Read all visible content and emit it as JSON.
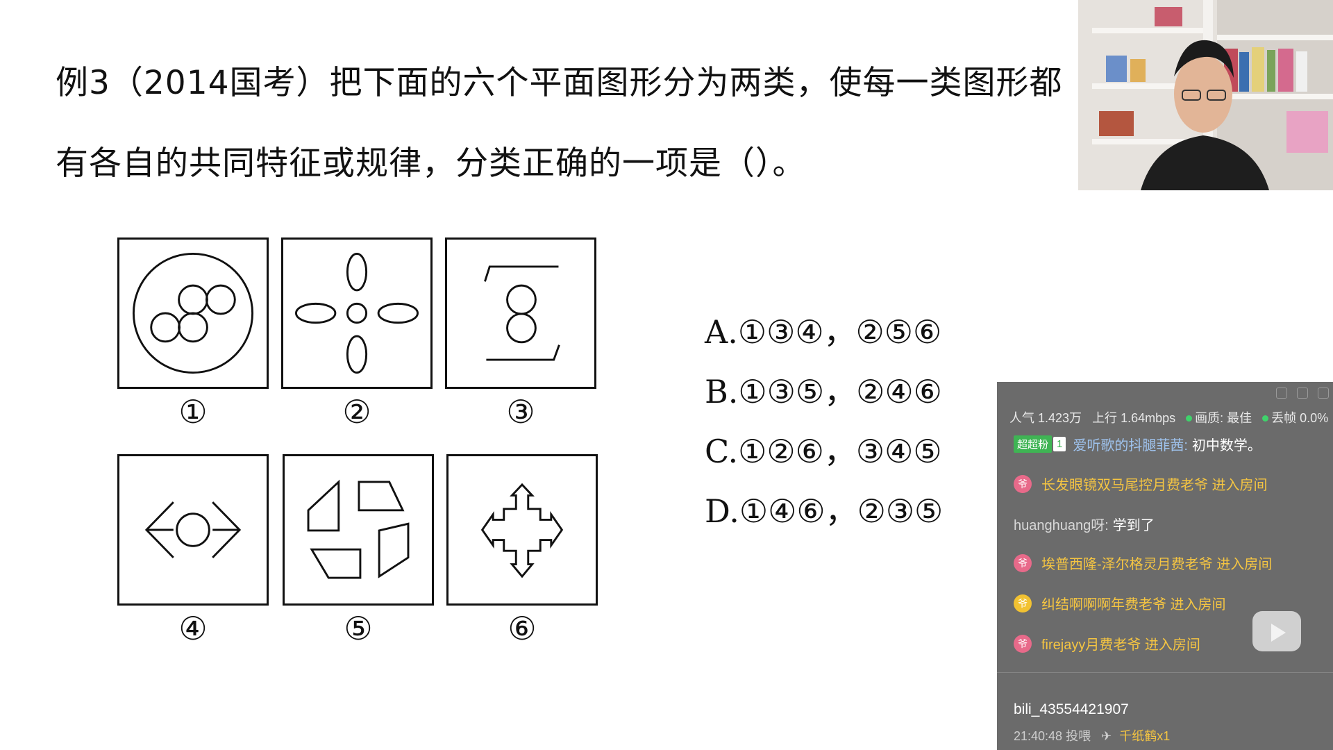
{
  "question": {
    "line1": "例3（2014国考）把下面的六个平面图形分为两类，使每一类图形都",
    "line2": "有各自的共同特征或规律，分类正确的一项是（）。"
  },
  "figures": [
    "①",
    "②",
    "③",
    "④",
    "⑤",
    "⑥"
  ],
  "options": [
    "A.①③④，②⑤⑥",
    "B.①③⑤，②④⑥",
    "C.①②⑥，③④⑤",
    "D.①④⑥，②③⑤"
  ],
  "chat": {
    "stats": {
      "popularity": "人气 1.423万",
      "upload": "上行 1.64mbps",
      "quality": "画质: 最佳",
      "dropped": "丢帧 0.0%"
    },
    "messages": [
      {
        "badge": "超超粉",
        "level": "1",
        "user": "爱听歌的抖腿菲茜:",
        "text": "初中数学。"
      },
      {
        "icon": "爷",
        "text": "长发眼镜双马尾控月费老爷 进入房间"
      },
      {
        "user": "huanghuang呀:",
        "text": "学到了"
      },
      {
        "icon": "爷",
        "text": "埃普西隆-泽尔格灵月费老爷 进入房间"
      },
      {
        "icon": "爷",
        "text": "纠结啊啊啊年费老爷 进入房间"
      },
      {
        "icon": "爷",
        "text": "firejayy月费老爷 进入房间"
      }
    ],
    "gift_user": "bili_43554421907",
    "gift_time": "21:40:48 投喂",
    "gift_name": "千纸鹤x1"
  },
  "colors": {
    "chat_bg": "#6b6b6b",
    "entry_text": "#f5c542",
    "username": "#9fc3ee",
    "fan_badge": "#3fb454"
  }
}
